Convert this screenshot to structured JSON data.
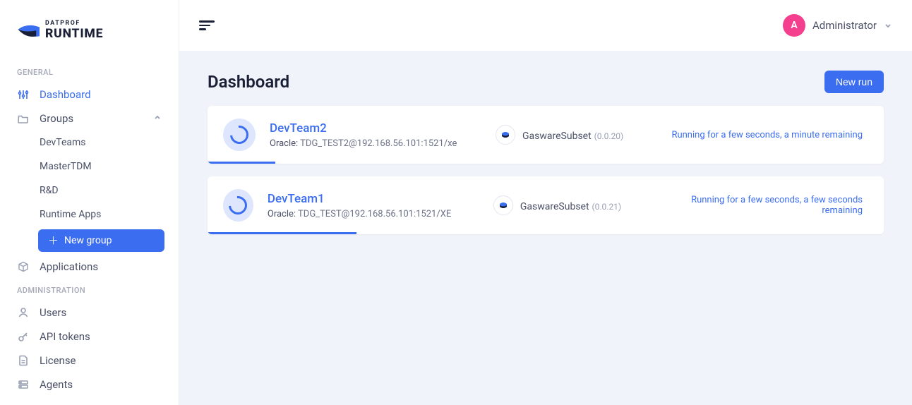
{
  "brand": {
    "top": "DATPROF",
    "bottom": "RUNTIME"
  },
  "sidebar": {
    "sections": {
      "general": "GENERAL",
      "admin": "ADMINISTRATION"
    },
    "dashboard": "Dashboard",
    "groups": {
      "label": "Groups",
      "items": [
        "DevTeams",
        "MasterTDM",
        "R&D",
        "Runtime Apps"
      ],
      "newGroup": "New group"
    },
    "applications": "Applications",
    "admin": {
      "users": "Users",
      "apiTokens": "API tokens",
      "license": "License",
      "agents": "Agents"
    }
  },
  "topbar": {
    "user": {
      "initial": "A",
      "name": "Administrator"
    }
  },
  "page": {
    "title": "Dashboard",
    "newRun": "New run"
  },
  "runs": [
    {
      "name": "DevTeam2",
      "connLabel": "Oracle:",
      "conn": "TDG_TEST2@192.168.56.101:1521/xe",
      "subset": "GaswareSubset",
      "version": "(0.0.20)",
      "status": "Running for a few seconds, a minute remaining",
      "progressPct": 10
    },
    {
      "name": "DevTeam1",
      "connLabel": "Oracle:",
      "conn": "TDG_TEST@192.168.56.101:1521/XE",
      "subset": "GaswareSubset",
      "version": "(0.0.21)",
      "status": "Running for a few seconds, a few seconds remaining",
      "progressPct": 22
    }
  ]
}
